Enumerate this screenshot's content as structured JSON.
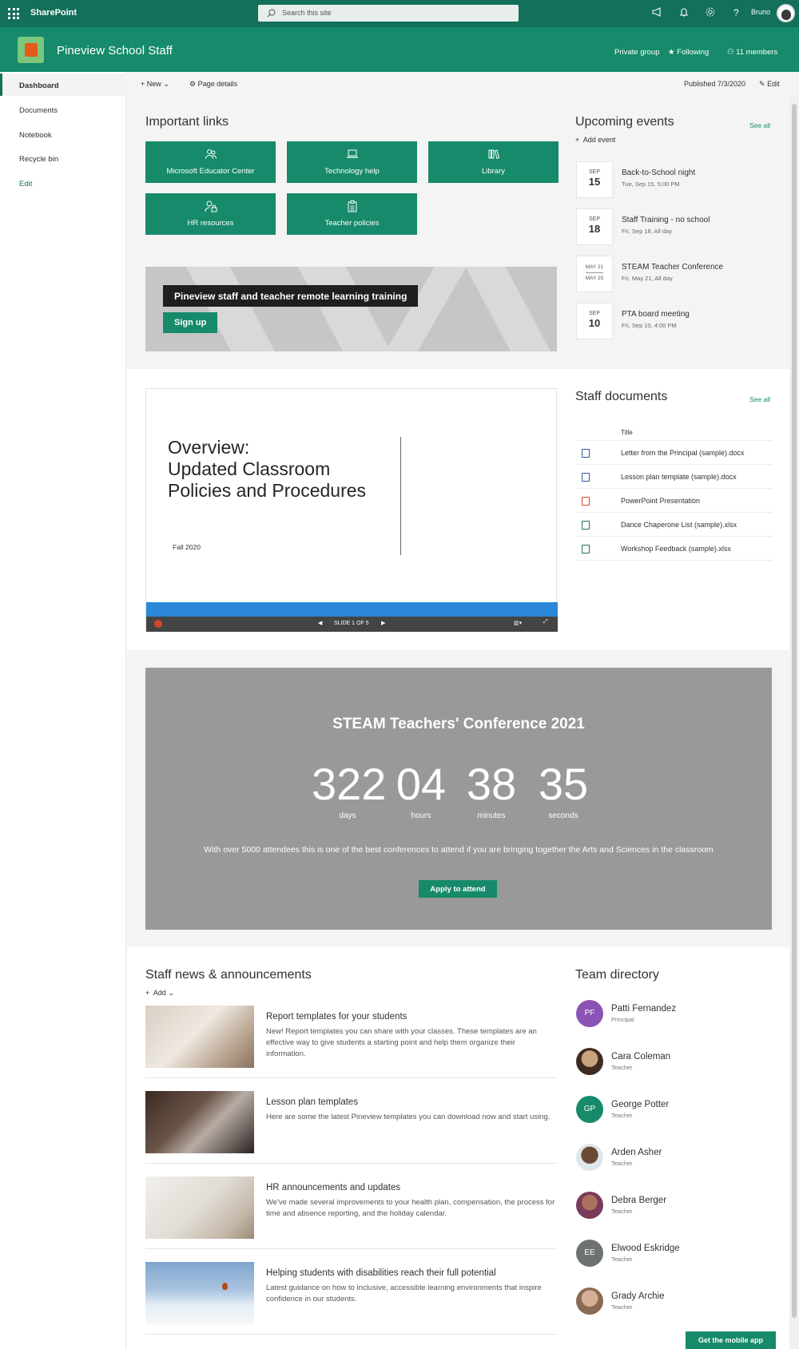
{
  "suite": {
    "brand": "SharePoint",
    "search_placeholder": "Search this site",
    "user": "Bruno"
  },
  "site": {
    "title": "Pineview School Staff",
    "privacy": "Private group",
    "following": "Following",
    "members": "11 members"
  },
  "nav": {
    "items": [
      "Dashboard",
      "Documents",
      "Notebook",
      "Recycle bin"
    ],
    "edit": "Edit",
    "active": "Dashboard"
  },
  "command": {
    "new": "New",
    "page_details": "Page details",
    "published": "Published 7/3/2020",
    "edit": "Edit"
  },
  "links": {
    "title": "Important links",
    "items": [
      {
        "label": "Microsoft Educator Center",
        "icon": "people-icon"
      },
      {
        "label": "Technology help",
        "icon": "laptop-icon"
      },
      {
        "label": "Library",
        "icon": "library-icon"
      },
      {
        "label": "HR resources",
        "icon": "person-lock-icon"
      },
      {
        "label": "Teacher policies",
        "icon": "clipboard-icon"
      }
    ]
  },
  "hero": {
    "title": "Pineview staff and teacher remote learning training",
    "button": "Sign up"
  },
  "events": {
    "title": "Upcoming events",
    "see_all": "See all",
    "add": "Add event",
    "items": [
      {
        "month": "SEP",
        "day": "15",
        "title": "Back-to-School night",
        "sub": "Tue, Sep 15, 5:00 PM"
      },
      {
        "month": "SEP",
        "day": "18",
        "title": "Staff Training - no school",
        "sub": "Fri, Sep 18, All day"
      },
      {
        "range_start": "MAY 21",
        "range_end": "MAY 25",
        "title": "STEAM Teacher Conference",
        "sub": "Fri, May 21, All day"
      },
      {
        "month": "SEP",
        "day": "10",
        "title": "PTA board meeting",
        "sub": "Fri, Sep 10, 4:00 PM"
      }
    ]
  },
  "ppt": {
    "title": "Overview:\nUpdated Classroom\nPolicies and Procedures",
    "subtitle": "Fall 2020",
    "slide": "SLIDE 1 OF 5"
  },
  "docs": {
    "title": "Staff documents",
    "see_all": "See all",
    "column": "Title",
    "items": [
      {
        "name": "Letter from the Principal (sample).docx",
        "color": "#2b579a"
      },
      {
        "name": "Lesson plan template (sample).docx",
        "color": "#2b579a"
      },
      {
        "name": "PowerPoint Presentation",
        "color": "#d24726"
      },
      {
        "name": "Dance Chaperone List (sample).xlsx",
        "color": "#217346"
      },
      {
        "name": "Workshop Feedback (sample).xlsx",
        "color": "#217346"
      }
    ]
  },
  "countdown": {
    "title": "STEAM Teachers' Conference 2021",
    "units": [
      {
        "value": "322",
        "label": "days"
      },
      {
        "value": "04",
        "label": "hours"
      },
      {
        "value": "38",
        "label": "minutes"
      },
      {
        "value": "35",
        "label": "seconds"
      }
    ],
    "description": "With over 5000 attendees this is one of the best conferences to attend if you are bringing together the Arts and Sciences in the classroom",
    "button": "Apply to attend"
  },
  "news": {
    "title": "Staff news & announcements",
    "add": "Add",
    "items": [
      {
        "title": "Report templates for your students",
        "desc": "New! Report templates you can share with your classes. These templates are an effective way to give students a starting point and help them organize their information."
      },
      {
        "title": "Lesson plan templates",
        "desc": "Here are some the latest Pineview templates you can download now and start using."
      },
      {
        "title": "HR announcements and updates",
        "desc": "We've made several improvements to your health plan, compensation, the process for time and absence reporting, and the holiday calendar."
      },
      {
        "title": "Helping students with disabilities reach their full potential",
        "desc": "Latest guidance on how to inclusive, accessible learning environments that inspire confidence in our students."
      }
    ]
  },
  "directory": {
    "title": "Team directory",
    "people": [
      {
        "name": "Patti Fernandez",
        "role": "Principal",
        "initials": "PF",
        "color": "#8a53b5"
      },
      {
        "name": "Cara Coleman",
        "role": "Teacher",
        "initials": "",
        "color": "#c9a27e"
      },
      {
        "name": "George Potter",
        "role": "Teacher",
        "initials": "GP",
        "color": "#168a6a"
      },
      {
        "name": "Arden Asher",
        "role": "Teacher",
        "initials": "",
        "color": "#6b4a35"
      },
      {
        "name": "Debra Berger",
        "role": "Teacher",
        "initials": "",
        "color": "#7a3a5a"
      },
      {
        "name": "Elwood Eskridge",
        "role": "Teacher",
        "initials": "EE",
        "color": "#6e7272"
      },
      {
        "name": "Grady Archie",
        "role": "Teacher",
        "initials": "",
        "color": "#b0896e"
      }
    ]
  },
  "mobile": "Get the mobile app"
}
